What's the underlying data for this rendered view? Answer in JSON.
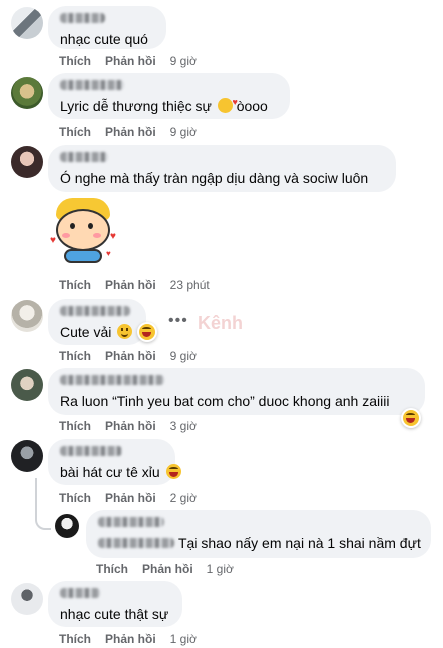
{
  "actions": {
    "like": "Thích",
    "reply": "Phản hồi"
  },
  "comments": [
    {
      "text": "nhạc cute quó",
      "time": "9 giờ"
    },
    {
      "text": "Lyric dễ thương thiệc sự",
      "suffix": "òooo",
      "time": "9 giờ"
    },
    {
      "text": "Ó nghe mà thấy tràn ngập dịu dàng và sociw luôn",
      "time": "23 phút"
    },
    {
      "text": "Cute vải",
      "time": "9 giờ"
    },
    {
      "text": "Ra luon “Tinh yeu bat com cho” duoc khong anh zaiiii",
      "time": "3 giờ"
    },
    {
      "text": "bài hát cư tê xỉu",
      "time": "2 giờ"
    },
    {
      "text": "Tại shao nấy em nại nà 1 shai nầm đựt",
      "time": "1 giờ"
    },
    {
      "text": "nhạc cute thật sự",
      "time": "1 giờ"
    }
  ],
  "more_label": "•••",
  "watermark": "Kênh"
}
